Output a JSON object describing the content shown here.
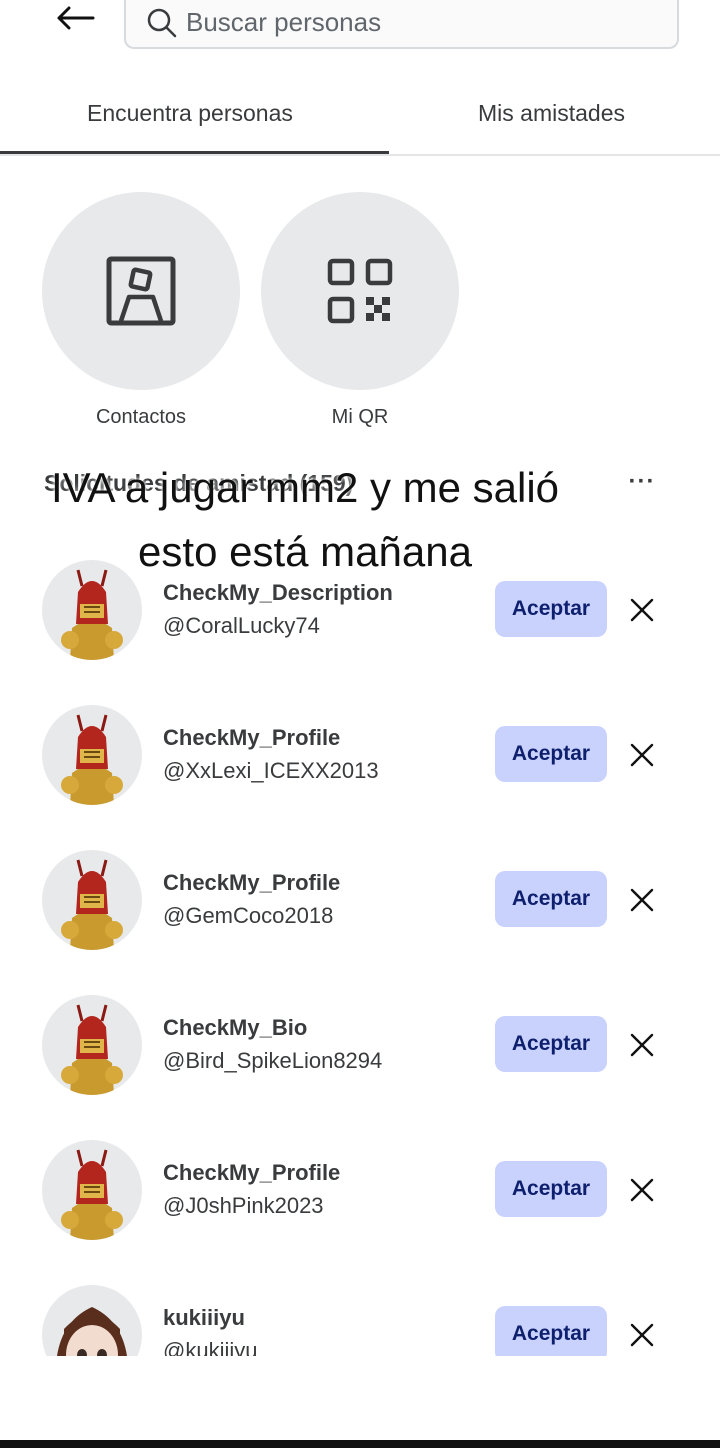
{
  "search": {
    "placeholder": "Buscar personas"
  },
  "tabs": [
    {
      "label": "Encuentra personas"
    },
    {
      "label": "Mis amistades"
    }
  ],
  "quick_actions": [
    {
      "label": "Contactos",
      "icon": "contact-card-icon"
    },
    {
      "label": "Mi QR",
      "icon": "qr-code-icon"
    }
  ],
  "requests_section": {
    "title": "Solicitudes de amistad (159)",
    "more_label": "···"
  },
  "overlay_caption": {
    "line1": "IVA a jugar mm2 y me salió",
    "line2": "esto está mañana"
  },
  "requests": [
    {
      "display_name": "CheckMy_Description",
      "username": "@CoralLucky74",
      "accept_label": "Aceptar",
      "avatar": "red-armor-knight"
    },
    {
      "display_name": "CheckMy_Profile",
      "username": "@XxLexi_ICEXX2013",
      "accept_label": "Aceptar",
      "avatar": "red-armor-knight"
    },
    {
      "display_name": "CheckMy_Profile",
      "username": "@GemCoco2018",
      "accept_label": "Aceptar",
      "avatar": "red-armor-knight"
    },
    {
      "display_name": "CheckMy_Bio",
      "username": "@Bird_SpikeLion8294",
      "accept_label": "Aceptar",
      "avatar": "red-armor-knight"
    },
    {
      "display_name": "CheckMy_Profile",
      "username": "@J0shPink2023",
      "accept_label": "Aceptar",
      "avatar": "red-armor-knight"
    },
    {
      "display_name": "kukiiiyu",
      "username": "@kukiiiyu",
      "accept_label": "Aceptar",
      "avatar": "brown-hair-girl"
    }
  ],
  "colors": {
    "accept_bg": "#c9d2fd",
    "accept_text": "#0e1f6e",
    "circle_bg": "#e7e9eb",
    "text": "#393b3d"
  }
}
